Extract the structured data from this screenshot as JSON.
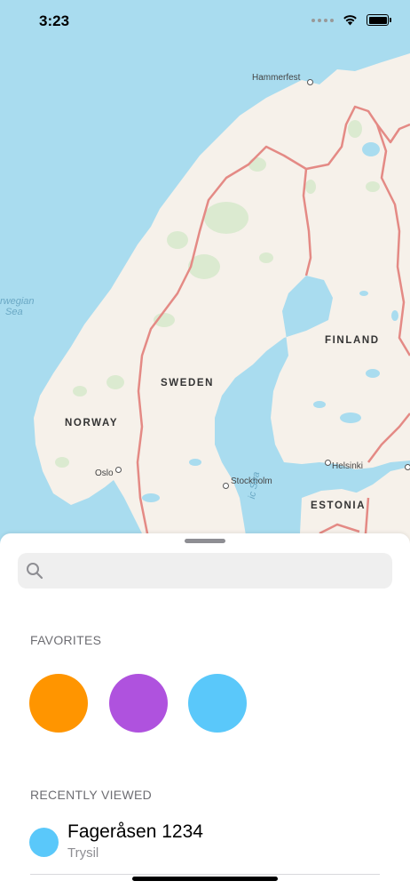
{
  "status_bar": {
    "time": "3:23"
  },
  "map": {
    "countries": {
      "norway": "NORWAY",
      "sweden": "SWEDEN",
      "finland": "FINLAND",
      "estonia": "ESTONIA"
    },
    "cities": {
      "hammerfest": "Hammerfest",
      "oslo": "Oslo",
      "stockholm": "Stockholm",
      "helsinki": "Helsinki"
    },
    "seas": {
      "norwegian_line1": "rwegian",
      "norwegian_line2": "Sea",
      "baltic": "ic Sea"
    }
  },
  "sheet": {
    "search": {
      "placeholder": "",
      "value": ""
    },
    "favorites_title": "FAVORITES",
    "favorites": [
      {
        "color": "#ff9500"
      },
      {
        "color": "#af52de"
      },
      {
        "color": "#5ac8fa"
      }
    ],
    "recent_title": "RECENTLY VIEWED",
    "recent": [
      {
        "name": "Fageråsen 1234",
        "subtitle": "Trysil",
        "color": "#5ac8fa"
      }
    ]
  },
  "colors": {
    "water": "#a9dcef",
    "land": "#f6f1ea",
    "forest": "#dbead0",
    "border": "#e48a85"
  }
}
